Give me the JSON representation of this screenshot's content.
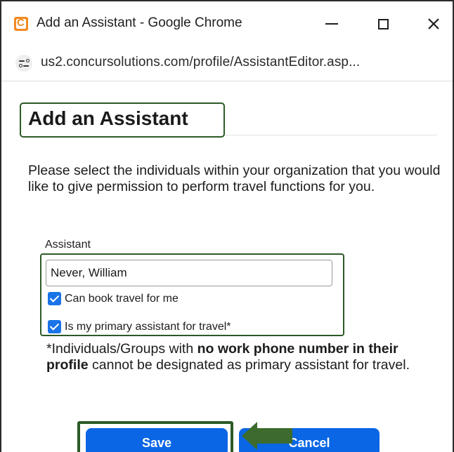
{
  "window": {
    "title": "Add an Assistant - Google Chrome",
    "url": "us2.concursolutions.com/profile/AssistantEditor.asp..."
  },
  "page": {
    "heading": "Add an Assistant",
    "intro": "Please select the individuals within your organization that you would like to give permission to perform travel functions for you.",
    "assistant_label": "Assistant",
    "assistant_value": "Never, William",
    "checkboxes": [
      {
        "label": "Can book travel for me",
        "checked": true
      },
      {
        "label": "Is my primary assistant for travel*",
        "checked": true
      }
    ],
    "note": {
      "part1": "*Individuals/Groups with ",
      "bold": "no work phone number in their profile",
      "part2": " cannot be designated as primary assistant for travel."
    },
    "buttons": {
      "save": "Save",
      "cancel": "Cancel"
    }
  },
  "colors": {
    "highlight_border": "#2d5a27",
    "button_blue": "#0a66e4",
    "checkbox_blue": "#1a73e8",
    "arrow_green": "#3d6b2e"
  },
  "icons": {
    "app": "concur-app-icon",
    "site_info": "site-info-icon",
    "minimize": "minimize-icon",
    "maximize": "maximize-icon",
    "close": "close-icon"
  }
}
